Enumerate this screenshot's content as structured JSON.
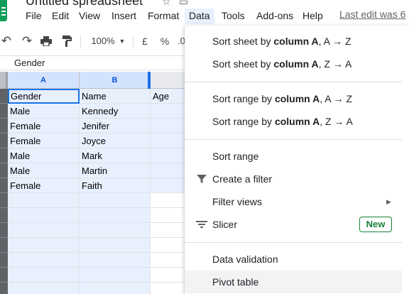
{
  "app": {
    "title": "Untitled spreadsheet",
    "last_edit": "Last edit was 6"
  },
  "menubar": {
    "items": [
      "File",
      "Edit",
      "View",
      "Insert",
      "Format",
      "Data",
      "Tools",
      "Add-ons",
      "Help"
    ],
    "active": "Data"
  },
  "toolbar": {
    "zoom": "100%",
    "currency": "£",
    "percent": "%",
    "decimal": ".0"
  },
  "formula_bar": {
    "value": "Gender"
  },
  "sheet": {
    "columns": [
      "A",
      "B"
    ],
    "rows": [
      [
        "Gender",
        "Name",
        "Age"
      ],
      [
        "Male",
        "Kennedy",
        ""
      ],
      [
        "Female",
        "Jenifer",
        ""
      ],
      [
        "Female",
        "Joyce",
        ""
      ],
      [
        "Male",
        "Mark",
        ""
      ],
      [
        "Male",
        "Martin",
        ""
      ],
      [
        "Female",
        "Faith",
        ""
      ]
    ]
  },
  "data_menu": {
    "sort_sheet_az": {
      "prefix": "Sort sheet by ",
      "bold": "column A",
      "suffix": ", A → Z"
    },
    "sort_sheet_za": {
      "prefix": "Sort sheet by ",
      "bold": "column A",
      "suffix": ", Z → A"
    },
    "sort_range_az": {
      "prefix": "Sort range by ",
      "bold": "column A",
      "suffix": ", A → Z"
    },
    "sort_range_za": {
      "prefix": "Sort range by ",
      "bold": "column A",
      "suffix": ", Z → A"
    },
    "sort_range": "Sort range",
    "create_filter": "Create a filter",
    "filter_views": "Filter views",
    "slicer": "Slicer",
    "slicer_badge": "New",
    "data_validation": "Data validation",
    "pivot_table": "Pivot table"
  },
  "colors": {
    "accent": "#1a73e8",
    "selection": "#e8f0fe",
    "new_badge": "#188038",
    "logo": "#0f9d58"
  }
}
